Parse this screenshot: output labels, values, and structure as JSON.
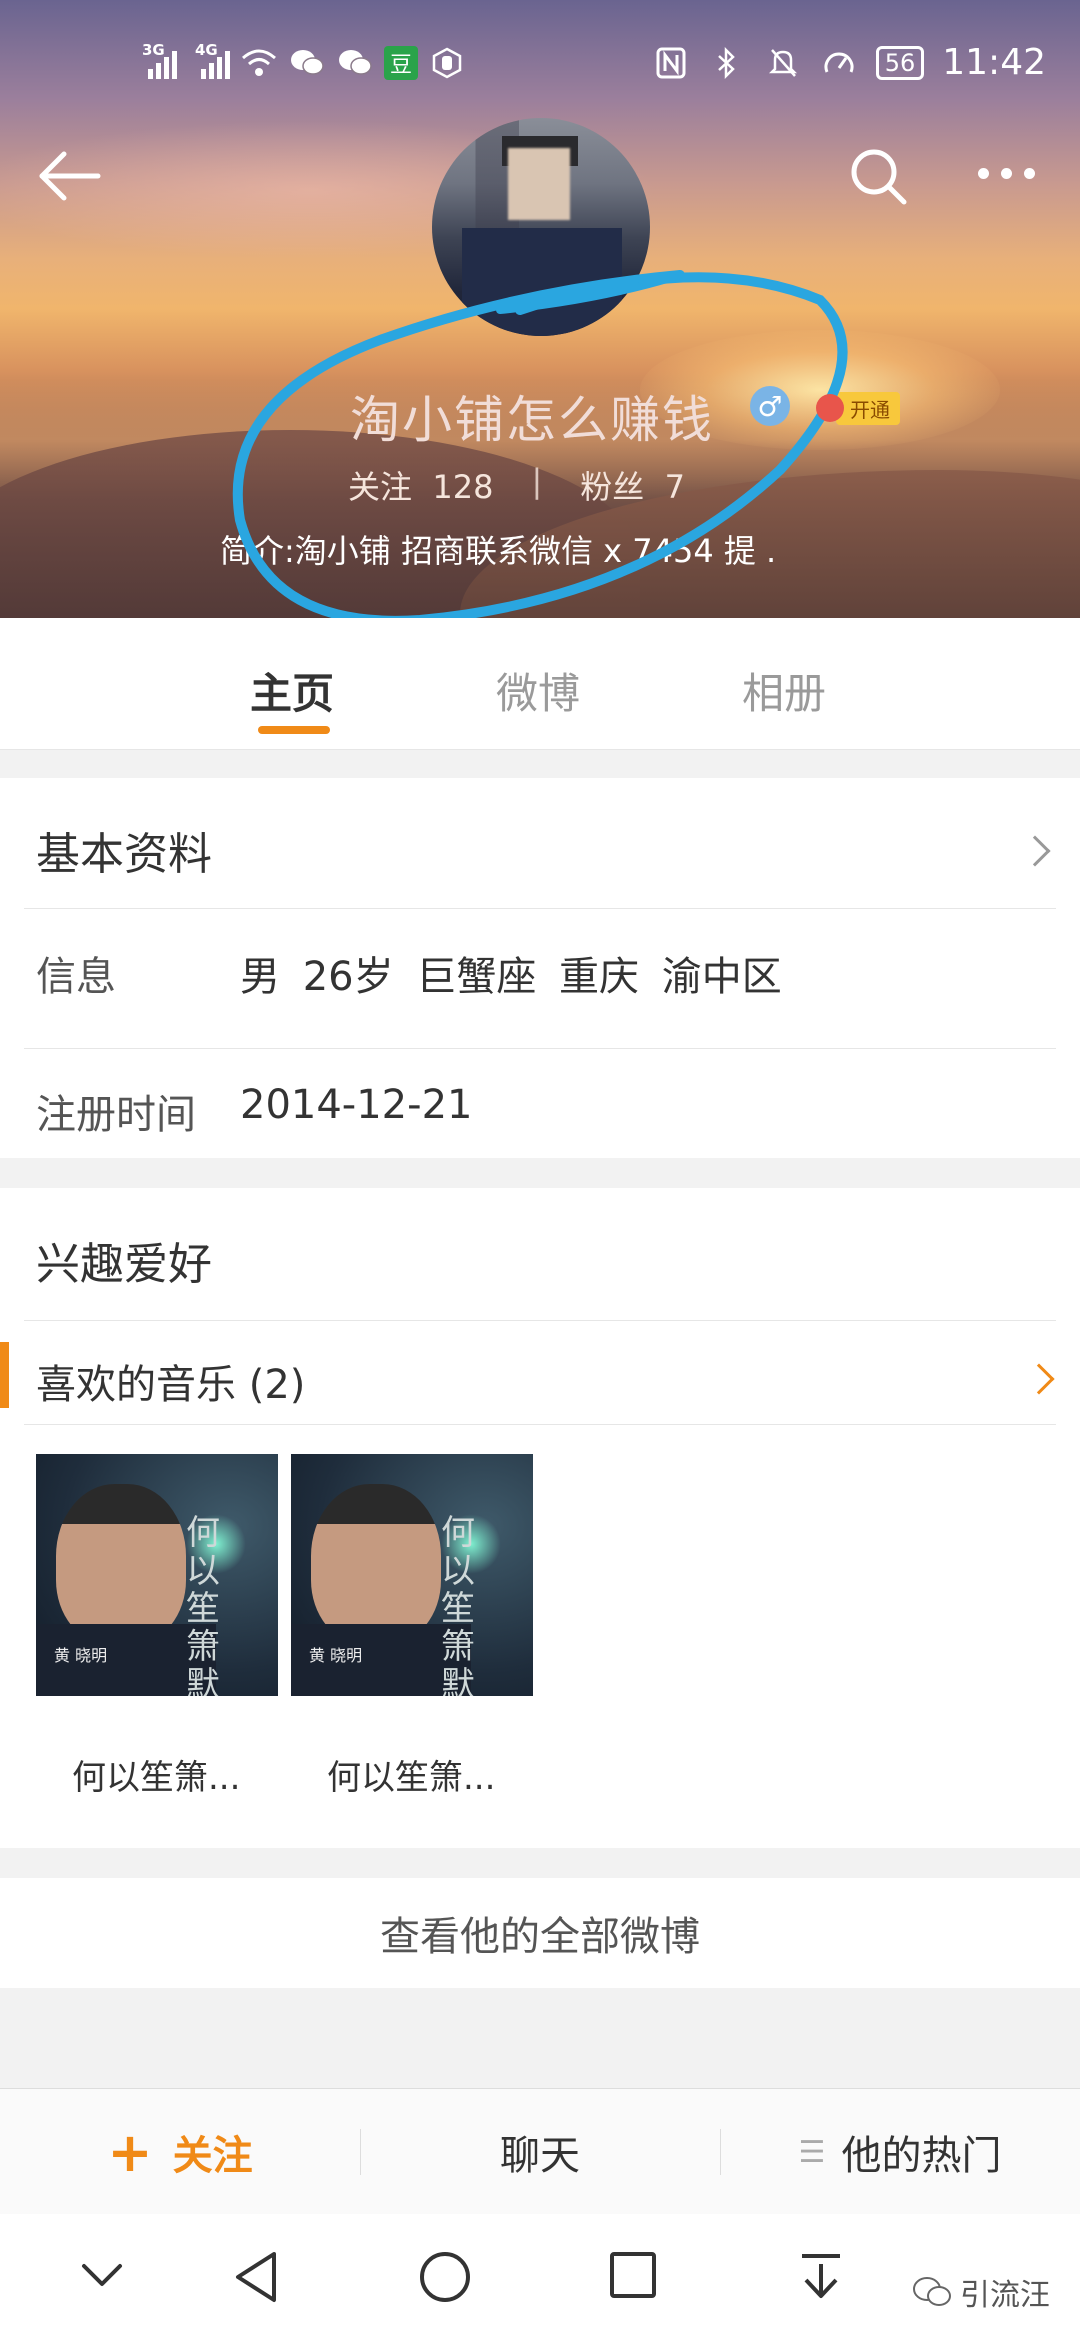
{
  "status_bar": {
    "net1": "3G",
    "net2": "4G",
    "app_badge": "豆",
    "battery": "56",
    "time": "11:42"
  },
  "profile": {
    "name": "淘小铺怎么赚钱",
    "gender_symbol": "♂",
    "vip_label": "开通",
    "following_label": "关注",
    "following_count": "128",
    "separator": "|",
    "followers_label": "粉丝",
    "followers_count": "7",
    "bio": "简介:淘小铺 招商联系微信 x  7454 提 ."
  },
  "tabs": [
    {
      "label": "主页",
      "active": true
    },
    {
      "label": "微博",
      "active": false
    },
    {
      "label": "相册",
      "active": false
    }
  ],
  "basic_info": {
    "title": "基本资料",
    "rows": [
      {
        "label": "信息",
        "value": "男  26岁  巨蟹座  重庆 渝中区"
      },
      {
        "label": "注册时间",
        "value": "2014-12-21"
      }
    ]
  },
  "interests": {
    "title": "兴趣爱好",
    "music_title": "喜欢的音乐 (2)",
    "albums": [
      {
        "caption": "何以笙箫...",
        "cover_text": "何以笙箫默",
        "singer": "黄 晓明"
      },
      {
        "caption": "何以笙箫...",
        "cover_text": "何以笙箫默",
        "singer": "黄 晓明"
      }
    ]
  },
  "view_all": "查看他的全部微博",
  "action_bar": {
    "follow": "关注",
    "chat": "聊天",
    "hot": "他的热门"
  },
  "watermark": "引流汪",
  "colors": {
    "accent": "#f08a17",
    "annotation_circle": "#2aa6e0"
  }
}
